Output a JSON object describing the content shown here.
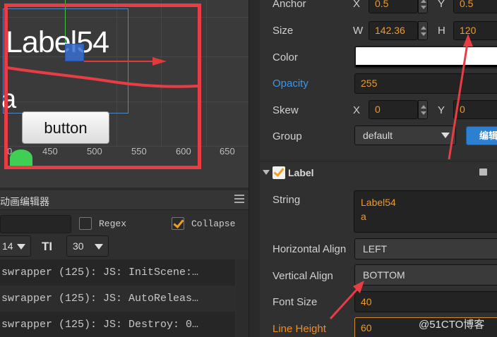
{
  "scene": {
    "label_text": "Label54",
    "label_second_line": "a",
    "button_text": "button",
    "ruler": [
      "0",
      "450",
      "500",
      "550",
      "600",
      "650"
    ]
  },
  "anim_panel": {
    "title": "动画编辑器",
    "regex_label": "Regex",
    "collapse_label": "Collapse",
    "font_select": "14",
    "size_select": "30",
    "tt_icon": "TI",
    "logs": [
      "swrapper (125): JS: InitScene:…",
      "swrapper (125): JS: AutoReleas…",
      "swrapper (125): JS: Destroy: 0…"
    ]
  },
  "inspector": {
    "anchor": {
      "label": "Anchor",
      "x_letter": "X",
      "x": "0.5",
      "y_letter": "Y",
      "y": "0.5"
    },
    "size": {
      "label": "Size",
      "w_letter": "W",
      "w": "142.36",
      "h_letter": "H",
      "h": "120"
    },
    "color": {
      "label": "Color",
      "value": "#ffffff"
    },
    "opacity": {
      "label": "Opacity",
      "value": "255"
    },
    "skew": {
      "label": "Skew",
      "x_letter": "X",
      "x": "0",
      "y_letter": "Y",
      "y": "0"
    },
    "group": {
      "label": "Group",
      "value": "default",
      "edit_button": "编辑"
    },
    "label_component": {
      "title": "Label",
      "string_label": "String",
      "string_lines": [
        "Label54",
        "a"
      ],
      "h_align_label": "Horizontal Align",
      "h_align": "LEFT",
      "v_align_label": "Vertical Align",
      "v_align": "BOTTOM",
      "font_size_label": "Font Size",
      "font_size": "40",
      "line_height_label": "Line Height",
      "line_height": "60"
    }
  },
  "watermark": "@51CTO博客",
  "colors": {
    "annotation_red": "#e93c45",
    "value_orange": "#f09a2a",
    "link_blue": "#3d95e8"
  }
}
